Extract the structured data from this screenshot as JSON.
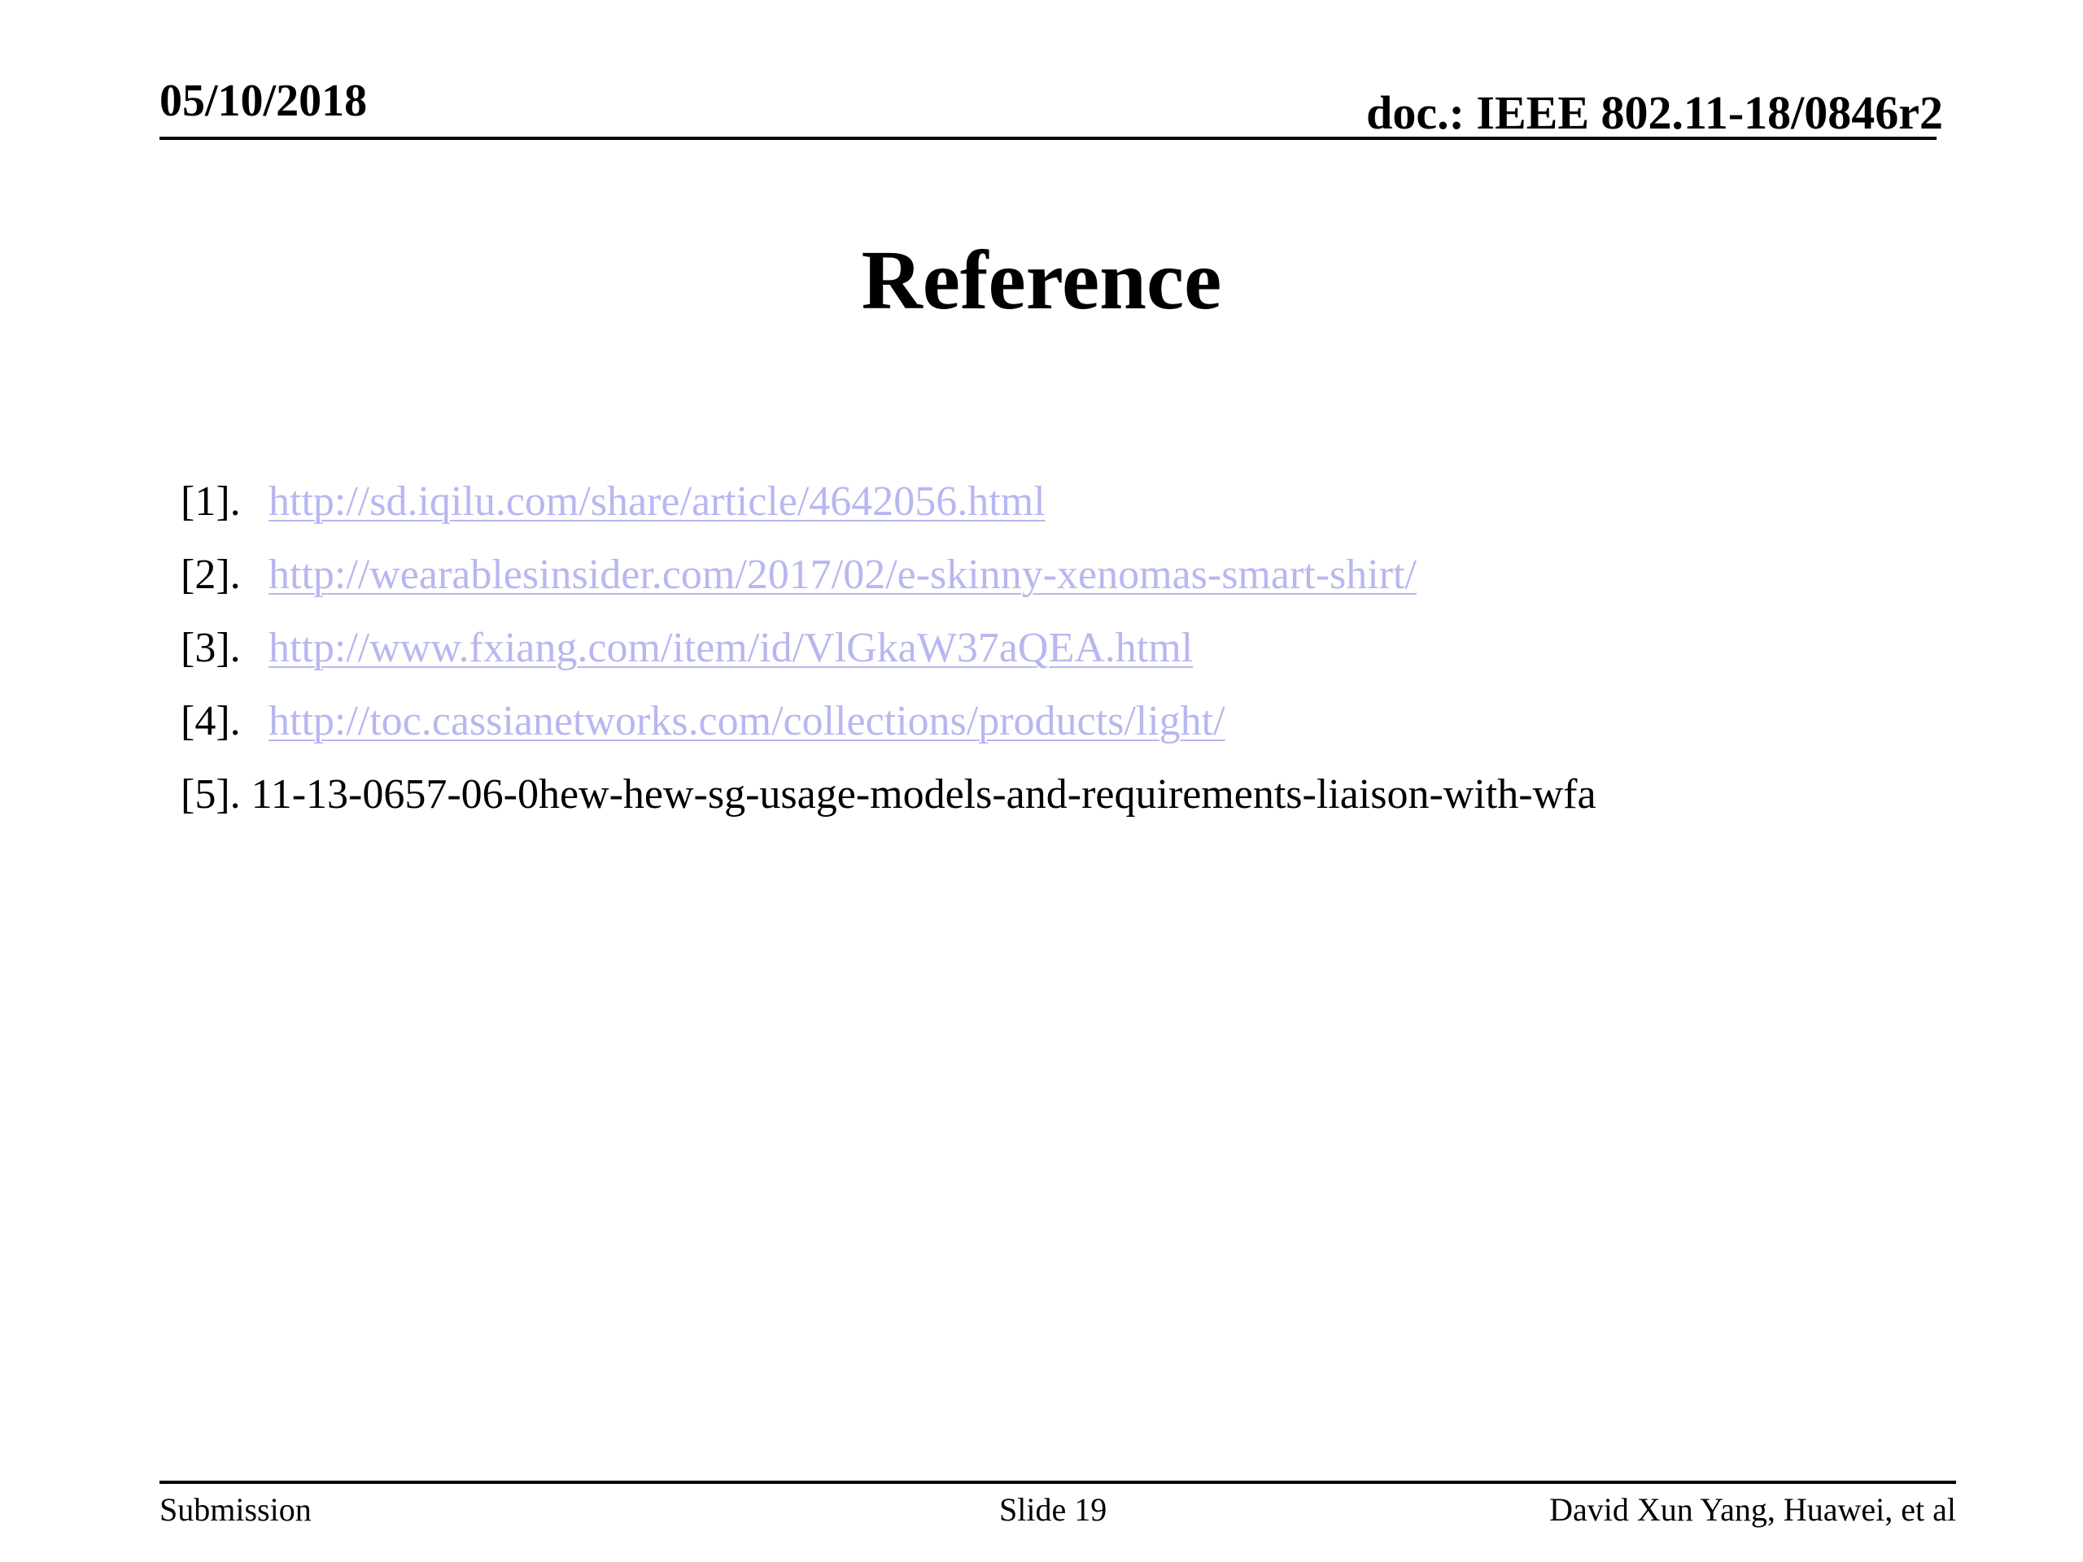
{
  "header": {
    "date": "05/10/2018",
    "doc_id": "doc.: IEEE 802.11-18/0846r2"
  },
  "title": "Reference",
  "references": [
    {
      "number": "[1].",
      "text": "http://sd.iqilu.com/share/article/4642056.html",
      "is_link": true
    },
    {
      "number": "[2].",
      "text": "http://wearablesinsider.com/2017/02/e-skinny-xenomas-smart-shirt/",
      "is_link": true
    },
    {
      "number": "[3].",
      "text": "http://www.fxiang.com/item/id/VlGkaW37aQEA.html",
      "is_link": true
    },
    {
      "number": "[4].",
      "text": "http://toc.cassianetworks.com/collections/products/light/",
      "is_link": true
    },
    {
      "number": "[5].",
      "text": "11-13-0657-06-0hew-hew-sg-usage-models-and-requirements-liaison-with-wfa",
      "is_link": false
    }
  ],
  "footer": {
    "left": "Submission",
    "center": "Slide 19",
    "right": "David Xun Yang, Huawei, et al"
  },
  "colors": {
    "link": "#b7b7f0",
    "text": "#000000",
    "background": "#ffffff"
  }
}
